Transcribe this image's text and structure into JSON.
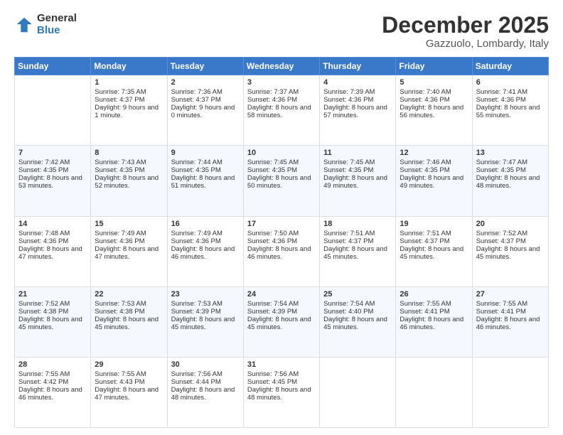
{
  "header": {
    "logo_general": "General",
    "logo_blue": "Blue",
    "month_title": "December 2025",
    "subtitle": "Gazzuolo, Lombardy, Italy"
  },
  "days_of_week": [
    "Sunday",
    "Monday",
    "Tuesday",
    "Wednesday",
    "Thursday",
    "Friday",
    "Saturday"
  ],
  "weeks": [
    [
      {
        "day": "",
        "sunrise": "",
        "sunset": "",
        "daylight": ""
      },
      {
        "day": "1",
        "sunrise": "Sunrise: 7:35 AM",
        "sunset": "Sunset: 4:37 PM",
        "daylight": "Daylight: 9 hours and 1 minute."
      },
      {
        "day": "2",
        "sunrise": "Sunrise: 7:36 AM",
        "sunset": "Sunset: 4:37 PM",
        "daylight": "Daylight: 9 hours and 0 minutes."
      },
      {
        "day": "3",
        "sunrise": "Sunrise: 7:37 AM",
        "sunset": "Sunset: 4:36 PM",
        "daylight": "Daylight: 8 hours and 58 minutes."
      },
      {
        "day": "4",
        "sunrise": "Sunrise: 7:39 AM",
        "sunset": "Sunset: 4:36 PM",
        "daylight": "Daylight: 8 hours and 57 minutes."
      },
      {
        "day": "5",
        "sunrise": "Sunrise: 7:40 AM",
        "sunset": "Sunset: 4:36 PM",
        "daylight": "Daylight: 8 hours and 56 minutes."
      },
      {
        "day": "6",
        "sunrise": "Sunrise: 7:41 AM",
        "sunset": "Sunset: 4:36 PM",
        "daylight": "Daylight: 8 hours and 55 minutes."
      }
    ],
    [
      {
        "day": "7",
        "sunrise": "Sunrise: 7:42 AM",
        "sunset": "Sunset: 4:35 PM",
        "daylight": "Daylight: 8 hours and 53 minutes."
      },
      {
        "day": "8",
        "sunrise": "Sunrise: 7:43 AM",
        "sunset": "Sunset: 4:35 PM",
        "daylight": "Daylight: 8 hours and 52 minutes."
      },
      {
        "day": "9",
        "sunrise": "Sunrise: 7:44 AM",
        "sunset": "Sunset: 4:35 PM",
        "daylight": "Daylight: 8 hours and 51 minutes."
      },
      {
        "day": "10",
        "sunrise": "Sunrise: 7:45 AM",
        "sunset": "Sunset: 4:35 PM",
        "daylight": "Daylight: 8 hours and 50 minutes."
      },
      {
        "day": "11",
        "sunrise": "Sunrise: 7:45 AM",
        "sunset": "Sunset: 4:35 PM",
        "daylight": "Daylight: 8 hours and 49 minutes."
      },
      {
        "day": "12",
        "sunrise": "Sunrise: 7:46 AM",
        "sunset": "Sunset: 4:35 PM",
        "daylight": "Daylight: 8 hours and 49 minutes."
      },
      {
        "day": "13",
        "sunrise": "Sunrise: 7:47 AM",
        "sunset": "Sunset: 4:35 PM",
        "daylight": "Daylight: 8 hours and 48 minutes."
      }
    ],
    [
      {
        "day": "14",
        "sunrise": "Sunrise: 7:48 AM",
        "sunset": "Sunset: 4:36 PM",
        "daylight": "Daylight: 8 hours and 47 minutes."
      },
      {
        "day": "15",
        "sunrise": "Sunrise: 7:49 AM",
        "sunset": "Sunset: 4:36 PM",
        "daylight": "Daylight: 8 hours and 47 minutes."
      },
      {
        "day": "16",
        "sunrise": "Sunrise: 7:49 AM",
        "sunset": "Sunset: 4:36 PM",
        "daylight": "Daylight: 8 hours and 46 minutes."
      },
      {
        "day": "17",
        "sunrise": "Sunrise: 7:50 AM",
        "sunset": "Sunset: 4:36 PM",
        "daylight": "Daylight: 8 hours and 46 minutes."
      },
      {
        "day": "18",
        "sunrise": "Sunrise: 7:51 AM",
        "sunset": "Sunset: 4:37 PM",
        "daylight": "Daylight: 8 hours and 45 minutes."
      },
      {
        "day": "19",
        "sunrise": "Sunrise: 7:51 AM",
        "sunset": "Sunset: 4:37 PM",
        "daylight": "Daylight: 8 hours and 45 minutes."
      },
      {
        "day": "20",
        "sunrise": "Sunrise: 7:52 AM",
        "sunset": "Sunset: 4:37 PM",
        "daylight": "Daylight: 8 hours and 45 minutes."
      }
    ],
    [
      {
        "day": "21",
        "sunrise": "Sunrise: 7:52 AM",
        "sunset": "Sunset: 4:38 PM",
        "daylight": "Daylight: 8 hours and 45 minutes."
      },
      {
        "day": "22",
        "sunrise": "Sunrise: 7:53 AM",
        "sunset": "Sunset: 4:38 PM",
        "daylight": "Daylight: 8 hours and 45 minutes."
      },
      {
        "day": "23",
        "sunrise": "Sunrise: 7:53 AM",
        "sunset": "Sunset: 4:39 PM",
        "daylight": "Daylight: 8 hours and 45 minutes."
      },
      {
        "day": "24",
        "sunrise": "Sunrise: 7:54 AM",
        "sunset": "Sunset: 4:39 PM",
        "daylight": "Daylight: 8 hours and 45 minutes."
      },
      {
        "day": "25",
        "sunrise": "Sunrise: 7:54 AM",
        "sunset": "Sunset: 4:40 PM",
        "daylight": "Daylight: 8 hours and 45 minutes."
      },
      {
        "day": "26",
        "sunrise": "Sunrise: 7:55 AM",
        "sunset": "Sunset: 4:41 PM",
        "daylight": "Daylight: 8 hours and 46 minutes."
      },
      {
        "day": "27",
        "sunrise": "Sunrise: 7:55 AM",
        "sunset": "Sunset: 4:41 PM",
        "daylight": "Daylight: 8 hours and 46 minutes."
      }
    ],
    [
      {
        "day": "28",
        "sunrise": "Sunrise: 7:55 AM",
        "sunset": "Sunset: 4:42 PM",
        "daylight": "Daylight: 8 hours and 46 minutes."
      },
      {
        "day": "29",
        "sunrise": "Sunrise: 7:55 AM",
        "sunset": "Sunset: 4:43 PM",
        "daylight": "Daylight: 8 hours and 47 minutes."
      },
      {
        "day": "30",
        "sunrise": "Sunrise: 7:56 AM",
        "sunset": "Sunset: 4:44 PM",
        "daylight": "Daylight: 8 hours and 48 minutes."
      },
      {
        "day": "31",
        "sunrise": "Sunrise: 7:56 AM",
        "sunset": "Sunset: 4:45 PM",
        "daylight": "Daylight: 8 hours and 48 minutes."
      },
      {
        "day": "",
        "sunrise": "",
        "sunset": "",
        "daylight": ""
      },
      {
        "day": "",
        "sunrise": "",
        "sunset": "",
        "daylight": ""
      },
      {
        "day": "",
        "sunrise": "",
        "sunset": "",
        "daylight": ""
      }
    ]
  ]
}
